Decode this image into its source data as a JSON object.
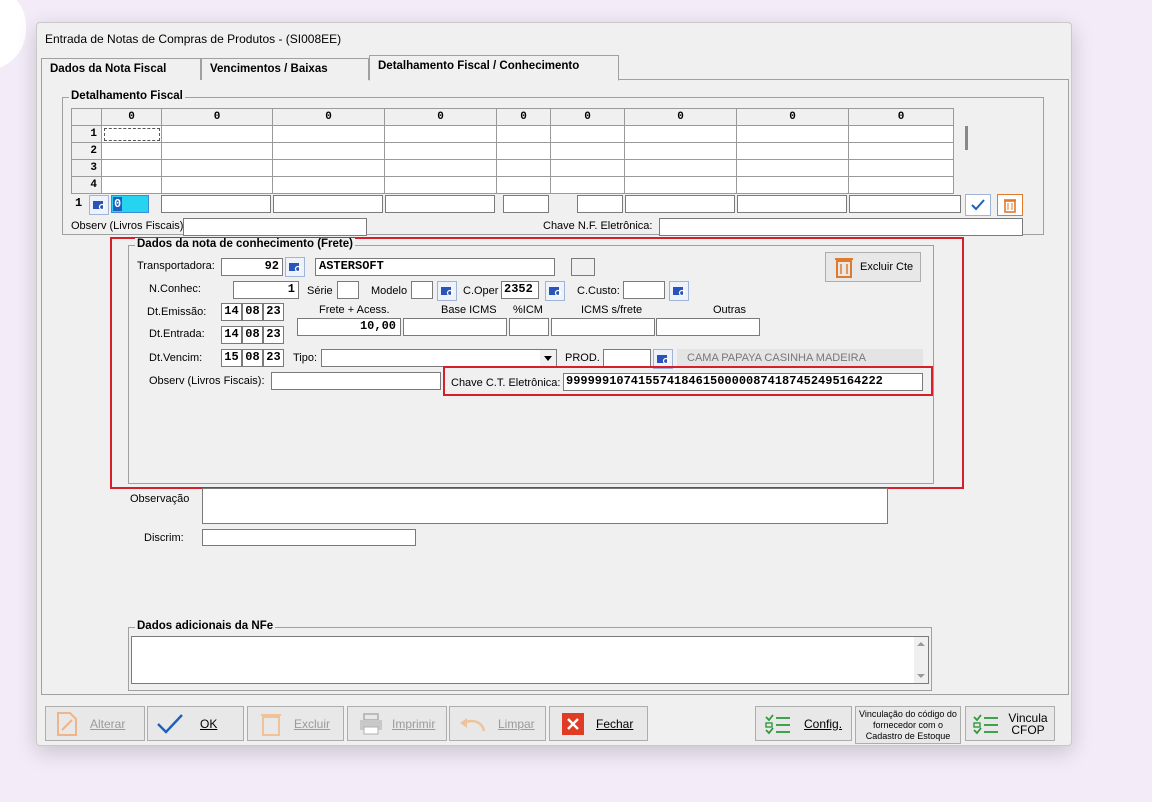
{
  "window": {
    "title": "Entrada de Notas de Compras de Produtos  - (SI008EE)"
  },
  "tabs": [
    {
      "label": "Dados da Nota Fiscal"
    },
    {
      "label": "Vencimentos / Baixas"
    },
    {
      "label": "Detalhamento Fiscal / Conhecimento"
    }
  ],
  "fiscal": {
    "group_title": "Detalhamento Fiscal",
    "col_headers": [
      "0",
      "0",
      "0",
      "0",
      "0",
      "0",
      "0",
      "0",
      "0"
    ],
    "row_headers": [
      "1",
      "2",
      "3",
      "4"
    ],
    "row_index": "1",
    "first_value": "0",
    "observ_label": "Observ (Livros Fiscais):",
    "chave_label": "Chave N.F. Eletrônica:"
  },
  "frete": {
    "group_title": "Dados da nota de conhecimento (Frete)",
    "transportadora_label": "Transportadora:",
    "transportadora_code": "92",
    "transportadora_name": "ASTERSOFT",
    "excluir_cte": "Excluir Cte",
    "nconhec_label": "N.Conhec:",
    "nconhec_value": "1",
    "serie_label": "Série",
    "modelo_label": "Modelo",
    "coper_label": "C.Oper",
    "coper_value": "2352",
    "ccusto_label": "C.Custo:",
    "dt_emissao_label": "Dt.Emissão:",
    "dt_emissao": [
      "14",
      "08",
      "23"
    ],
    "dt_entrada_label": "Dt.Entrada:",
    "dt_entrada": [
      "14",
      "08",
      "23"
    ],
    "dt_vencim_label": "Dt.Vencim:",
    "dt_vencim": [
      "15",
      "08",
      "23"
    ],
    "frete_acess_label": "Frete + Acess.",
    "frete_acess_value": "10,00",
    "base_icms_label": "Base ICMS",
    "pct_icm_label": "%ICM",
    "icms_sfrete_label": "ICMS s/frete",
    "outras_label": "Outras",
    "tipo_label": "Tipo:",
    "prod_label": "PROD.",
    "prod_desc": "CAMA PAPAYA CASINHA MADEIRA",
    "observ_label": "Observ (Livros Fiscais):",
    "chave_label": "Chave C.T. Eletrônica:",
    "chave_value": "99999910741557418461500000874187452495164222"
  },
  "observacao_label": "Observação",
  "discrim_label": "Discrim:",
  "nfe_title": "Dados adicionais da NFe",
  "buttons": {
    "alterar": "Alterar",
    "ok": "OK",
    "excluir": "Excluir",
    "imprimir": "Imprimir",
    "limpar": "Limpar",
    "fechar": "Fechar",
    "config": "Config.",
    "vinculacao": "Vinculação do código do fornecedor com o Cadastro de Estoque",
    "vincula": "Vincula CFOP"
  },
  "colors": {
    "highlight": "#d81e2a",
    "accent": "#1f5fbf",
    "trash": "#e07a2c"
  }
}
